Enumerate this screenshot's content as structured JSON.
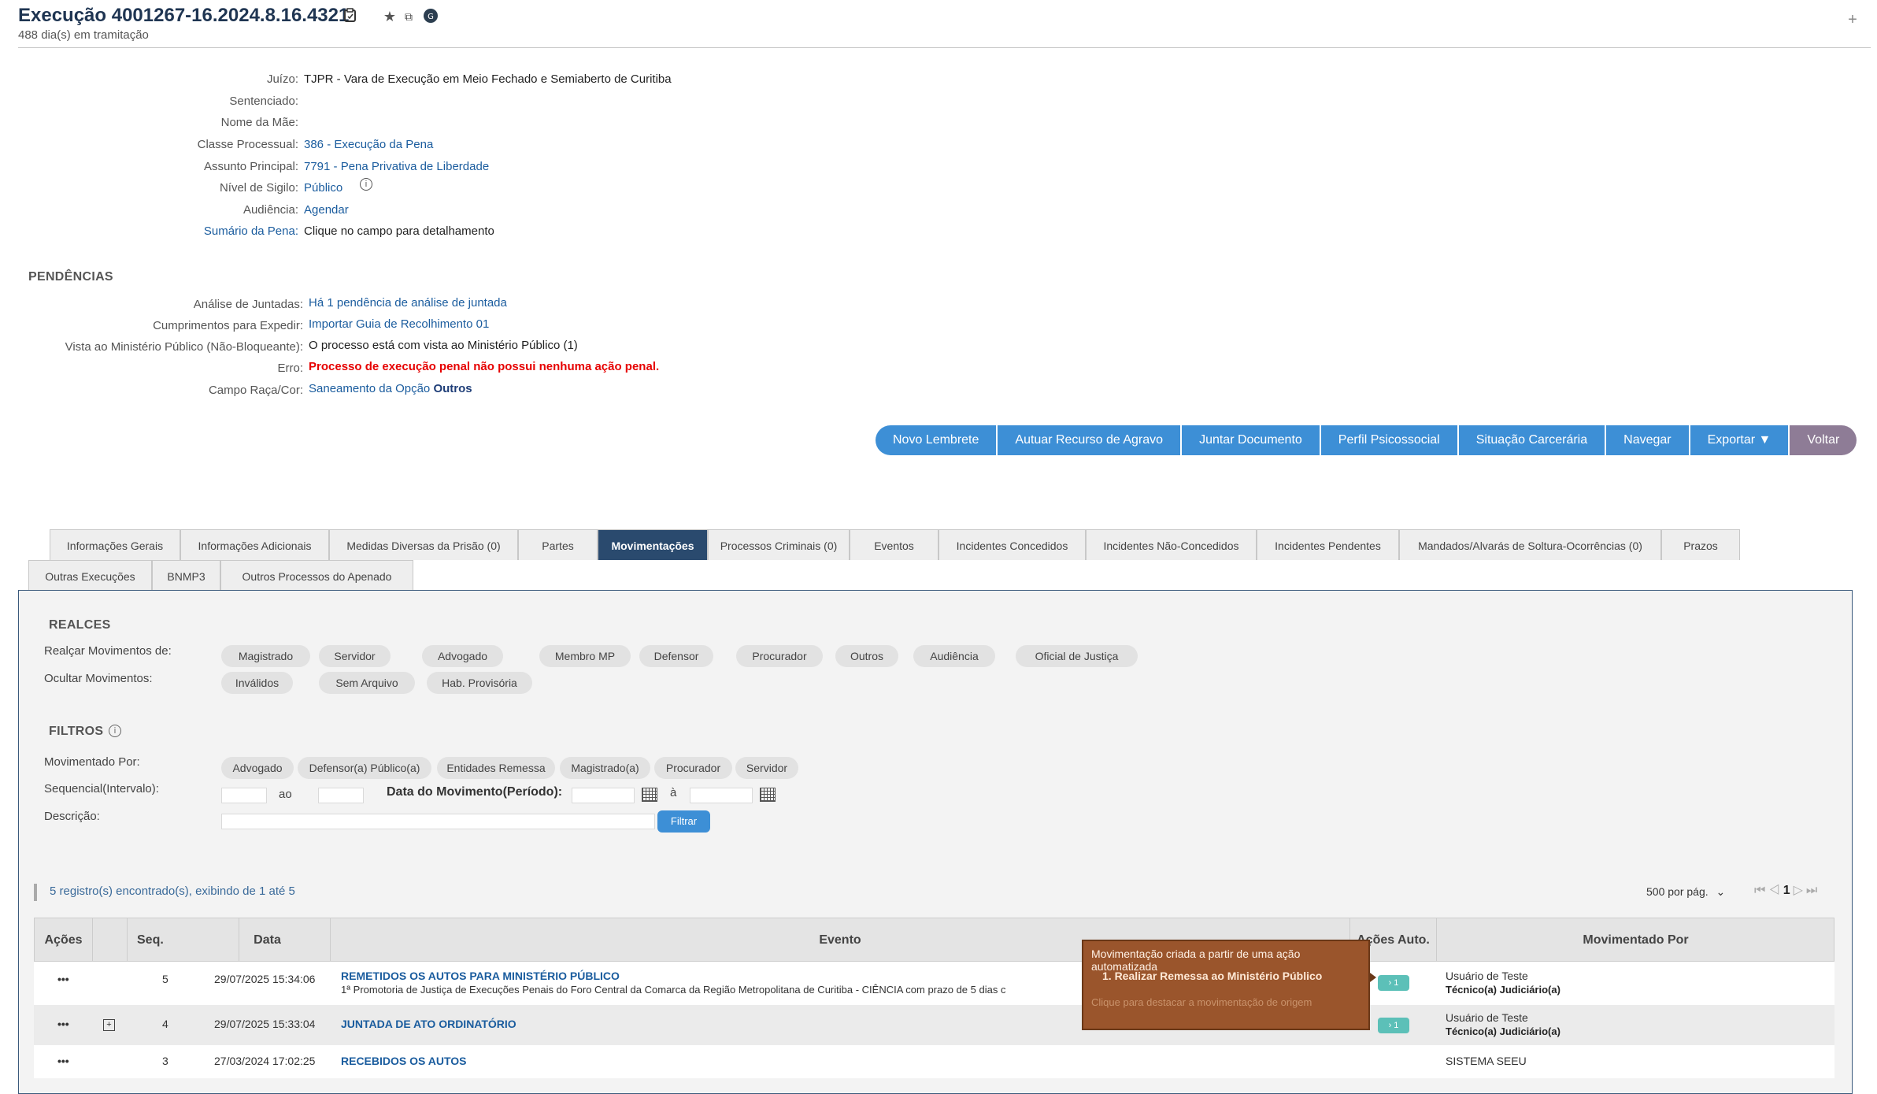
{
  "header": {
    "title": "Execução 4001267-16.2024.8.16.4321",
    "subtitle": "488 dia(s) em tramitação"
  },
  "details": {
    "juizo_label": "Juízo:",
    "juizo": "TJPR - Vara de Execução em Meio Fechado e Semiaberto de Curitiba",
    "sentenciado_label": "Sentenciado:",
    "sentenciado": "",
    "mae_label": "Nome da Mãe:",
    "mae": "",
    "classe_label": "Classe Processual:",
    "classe": "386 - Execução da Pena",
    "assunto_label": "Assunto Principal:",
    "assunto": "7791 - Pena Privativa de Liberdade",
    "sigilo_label": "Nível de Sigilo:",
    "sigilo": "Público",
    "audiencia_label": "Audiência:",
    "audiencia": "Agendar",
    "sumario_label": "Sumário da Pena:",
    "sumario": "Clique no campo para detalhamento"
  },
  "pendencias": {
    "title": "PENDÊNCIAS",
    "analise_label": "Análise de Juntadas:",
    "analise": "Há 1 pendência de análise de juntada",
    "cumprimentos_label": "Cumprimentos para Expedir:",
    "cumprimentos": "Importar Guia de Recolhimento 01",
    "vista_label": "Vista ao Ministério Público (Não-Bloqueante):",
    "vista": "O processo está com vista ao Ministério Público (1)",
    "erro_label": "Erro:",
    "erro": "Processo de execução penal não possui nenhuma ação penal.",
    "raca_label": "Campo Raça/Cor:",
    "raca_prefix": "Saneamento da Opção",
    "raca_bold": "Outros"
  },
  "actions": [
    "Novo Lembrete",
    "Autuar Recurso de Agravo",
    "Juntar Documento",
    "Perfil Psicossocial",
    "Situação Carcerária",
    "Navegar",
    "Exportar ▼",
    "Voltar"
  ],
  "tabs_row1": [
    "Informações Gerais",
    "Informações Adicionais",
    "Medidas Diversas da Prisão (0)",
    "Partes",
    "Movimentações",
    "Processos Criminais (0)",
    "Eventos",
    "Incidentes Concedidos",
    "Incidentes Não-Concedidos",
    "Incidentes Pendentes",
    "Mandados/Alvarás de Soltura-Ocorrências (0)",
    "Prazos"
  ],
  "tabs_row2": [
    "Outras Execuções",
    "BNMP3",
    "Outros Processos do Apenado"
  ],
  "active_tab": "Movimentações",
  "realces": {
    "title": "REALCES",
    "realcar_label": "Realçar Movimentos de:",
    "realcar": [
      "Magistrado",
      "Servidor",
      "Advogado",
      "Membro MP",
      "Defensor",
      "Procurador",
      "Outros",
      "Audiência",
      "Oficial de Justiça"
    ],
    "ocultar_label": "Ocultar Movimentos:",
    "ocultar": [
      "Inválidos",
      "Sem Arquivo",
      "Hab. Provisória"
    ]
  },
  "filtros": {
    "title": "FILTROS",
    "movimentado_label": "Movimentado Por:",
    "movimentado": [
      "Advogado",
      "Defensor(a) Público(a)",
      "Entidades Remessa",
      "Magistrado(a)",
      "Procurador",
      "Servidor"
    ],
    "seq_label": "Sequencial(Intervalo):",
    "ao": "ao",
    "data_label": "Data do Movimento(Período):",
    "a": "à",
    "desc_label": "Descrição:",
    "button": "Filtrar"
  },
  "records": {
    "summary": "5 registro(s) encontrado(s), exibindo de 1 até 5",
    "per_page": "500 por pág.",
    "current_page": "1"
  },
  "table": {
    "headers": [
      "Ações",
      "",
      "Seq.",
      "Data",
      "Evento",
      "Ações Auto.",
      "Movimentado Por"
    ],
    "rows": [
      {
        "acoes": "•••",
        "seq": "5",
        "data": "29/07/2025 15:34:06",
        "evento": "REMETIDOS OS AUTOS PARA MINISTÉRIO PÚBLICO",
        "detalhe": "1ª Promotoria de Justiça de Execuções Penais do Foro Central da Comarca da Região Metropolitana de Curitiba - CIÊNCIA com prazo de 5 dias c",
        "auto": "› 1",
        "mov1": "Usuário de Teste",
        "mov2": "Técnico(a) Judiciário(a)"
      },
      {
        "acoes": "•••",
        "seq": "4",
        "data": "29/07/2025 15:33:04",
        "evento": "JUNTADA DE ATO ORDINATÓRIO",
        "detalhe": "",
        "auto": "› 1",
        "mov1": "Usuário de Teste",
        "mov2": "Técnico(a) Judiciário(a)"
      },
      {
        "acoes": "•••",
        "seq": "3",
        "data": "27/03/2024 17:02:25",
        "evento": "RECEBIDOS OS AUTOS",
        "detalhe": "",
        "auto": "",
        "mov1": "SISTEMA SEEU",
        "mov2": ""
      }
    ]
  },
  "tooltip": {
    "title": "Movimentação criada a partir de uma ação automatizada",
    "item": "1. Realizar Remessa ao Ministério Público",
    "footer": "Clique para destacar a movimentação de origem"
  }
}
